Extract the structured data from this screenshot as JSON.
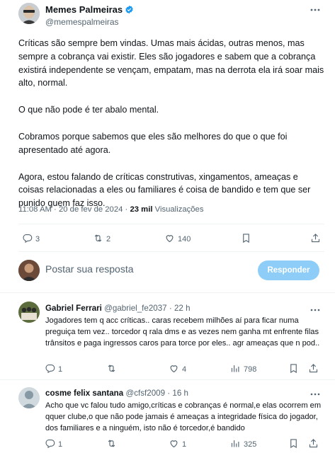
{
  "tweet": {
    "author_name": "Memes Palmeiras",
    "author_handle": "@memespalmeiras",
    "paragraphs": [
      "Críticas são sempre bem vindas. Umas mais ácidas, outras menos, mas sempre a cobrança vai existir. Eles são jogadores e sabem que a cobrança existirá independente se vençam, empatam, mas na derrota ela irá soar mais alto, normal.",
      "O que não pode é ter abalo mental.",
      "Cobramos porque sabemos que eles são melhores do que o que foi apresentado até agora.",
      "Agora, estou falando de críticas construtivas, xingamentos, ameaças e coisas relacionadas a eles ou familiares é coisa de bandido e tem que ser punido quem faz isso."
    ],
    "time": "11:08 AM",
    "date": "20 de fev de 2024",
    "views_count": "23 mil",
    "views_label": "Visualizações",
    "stats": {
      "replies": "3",
      "retweets": "2",
      "likes": "140"
    }
  },
  "reply_box": {
    "placeholder": "Postar sua resposta",
    "button_label": "Responder"
  },
  "replies": [
    {
      "name": "Gabriel Ferrari",
      "handle": "@gabriel_fe2037",
      "time": "22 h",
      "text": "Jogadores tem q acc críticas.. caras recebem milhões aí para ficar numa preguiça tem vez.. torcedor q rala dms e as vezes nem ganha mt enfrente filas trânsitos e paga ingressos caros para torce por eles.. agr ameaças que n pod..",
      "stats": {
        "replies": "1",
        "retweets": "",
        "likes": "4",
        "views": "798"
      }
    },
    {
      "name": "cosme felix santana",
      "handle": "@cfsf2009",
      "time": "16 h",
      "text": "Acho que vc falou tudo amigo,críticas e cobranças é normal,e elas ocorrem em qquer clube,o que não pode jamais é ameaças a integridade física do jogador, dos familiares e a ninguém, isto não é torcedor,é bandido",
      "stats": {
        "replies": "1",
        "retweets": "",
        "likes": "1",
        "views": "325"
      }
    }
  ],
  "colors": {
    "text_primary": "#0f1419",
    "text_secondary": "#536471",
    "verified_badge": "#1d9bf0",
    "reply_button": "#8ecdf8",
    "divider": "#eff3f4"
  },
  "icons": [
    "verified-badge-icon",
    "more-icon",
    "reply-icon",
    "retweet-icon",
    "like-icon",
    "views-icon",
    "bookmark-icon",
    "share-icon"
  ]
}
